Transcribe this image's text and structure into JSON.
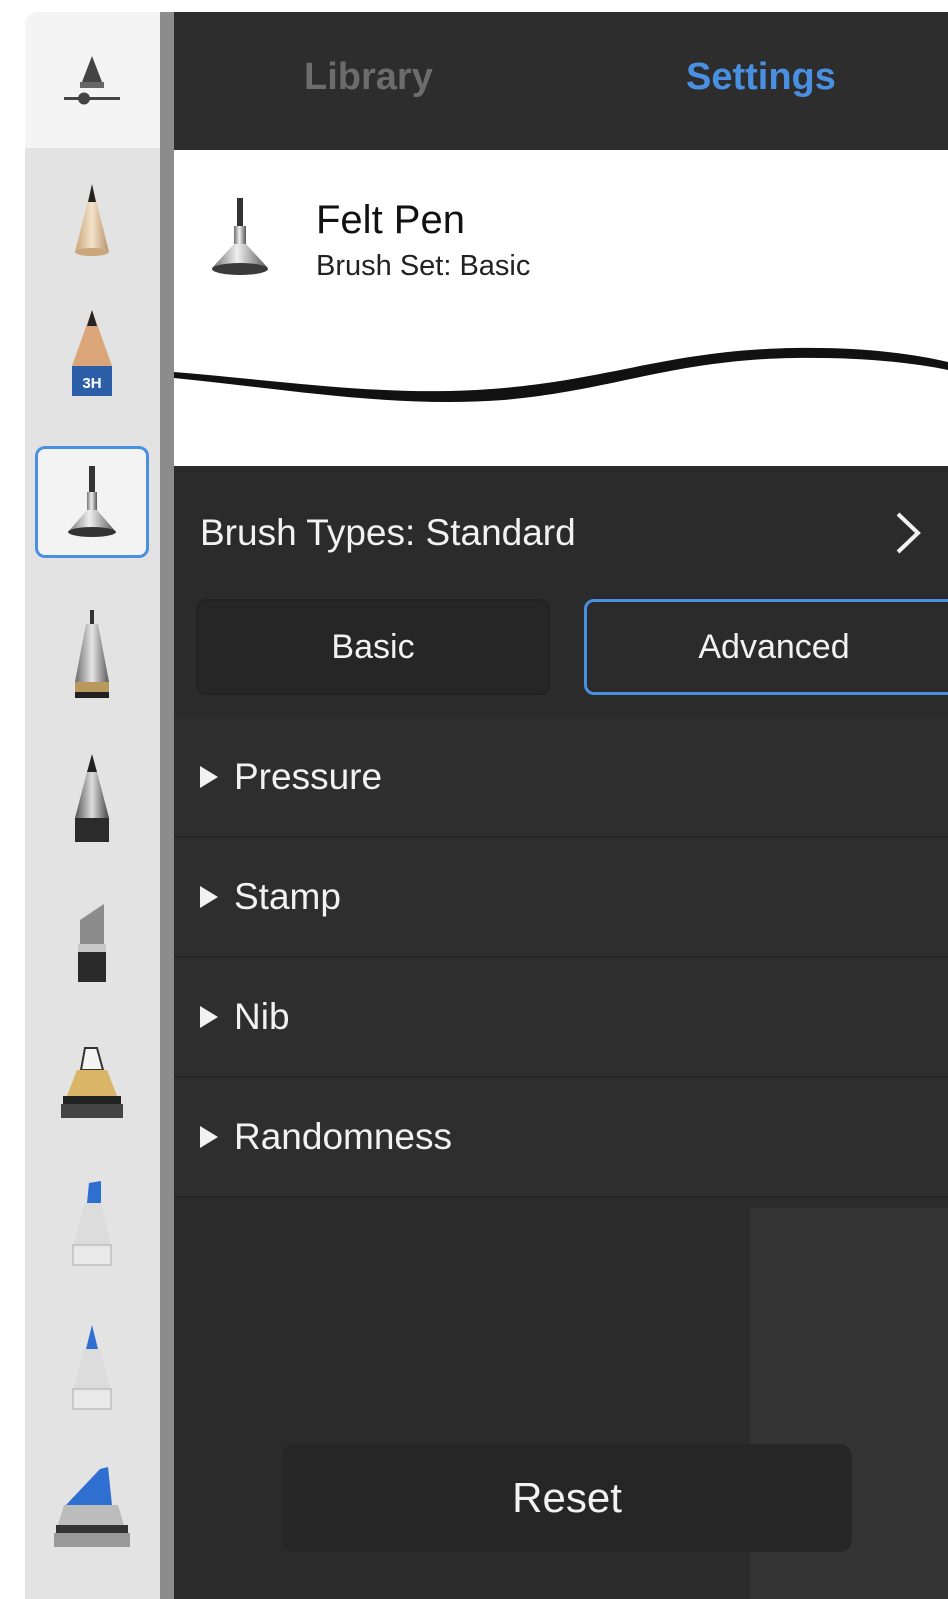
{
  "tabs": {
    "library": "Library",
    "settings": "Settings",
    "active": "Settings"
  },
  "brush": {
    "name": "Felt Pen",
    "set": "Brush Set: Basic"
  },
  "brush_types": {
    "label": "Brush Types: Standard"
  },
  "mode": {
    "basic": "Basic",
    "advanced": "Advanced",
    "selected": "Advanced"
  },
  "sections": [
    {
      "label": "Pressure"
    },
    {
      "label": "Stamp"
    },
    {
      "label": "Nib"
    },
    {
      "label": "Randomness"
    }
  ],
  "reset_label": "Reset",
  "sidebar": {
    "selected_tool": "felt-pen",
    "badge": "3H",
    "tools": [
      "brush-settings",
      "pen",
      "pencil-3h",
      "felt-pen",
      "technical-pen",
      "ballpoint-pen",
      "chisel-marker",
      "paint-marker",
      "highlighter",
      "marker",
      "airbrush"
    ]
  },
  "colors": {
    "accent": "#4a90e2",
    "panel": "#2b2b2b",
    "inactive_tab": "#6c6c6c",
    "sidebar": "#e3e3e3"
  }
}
